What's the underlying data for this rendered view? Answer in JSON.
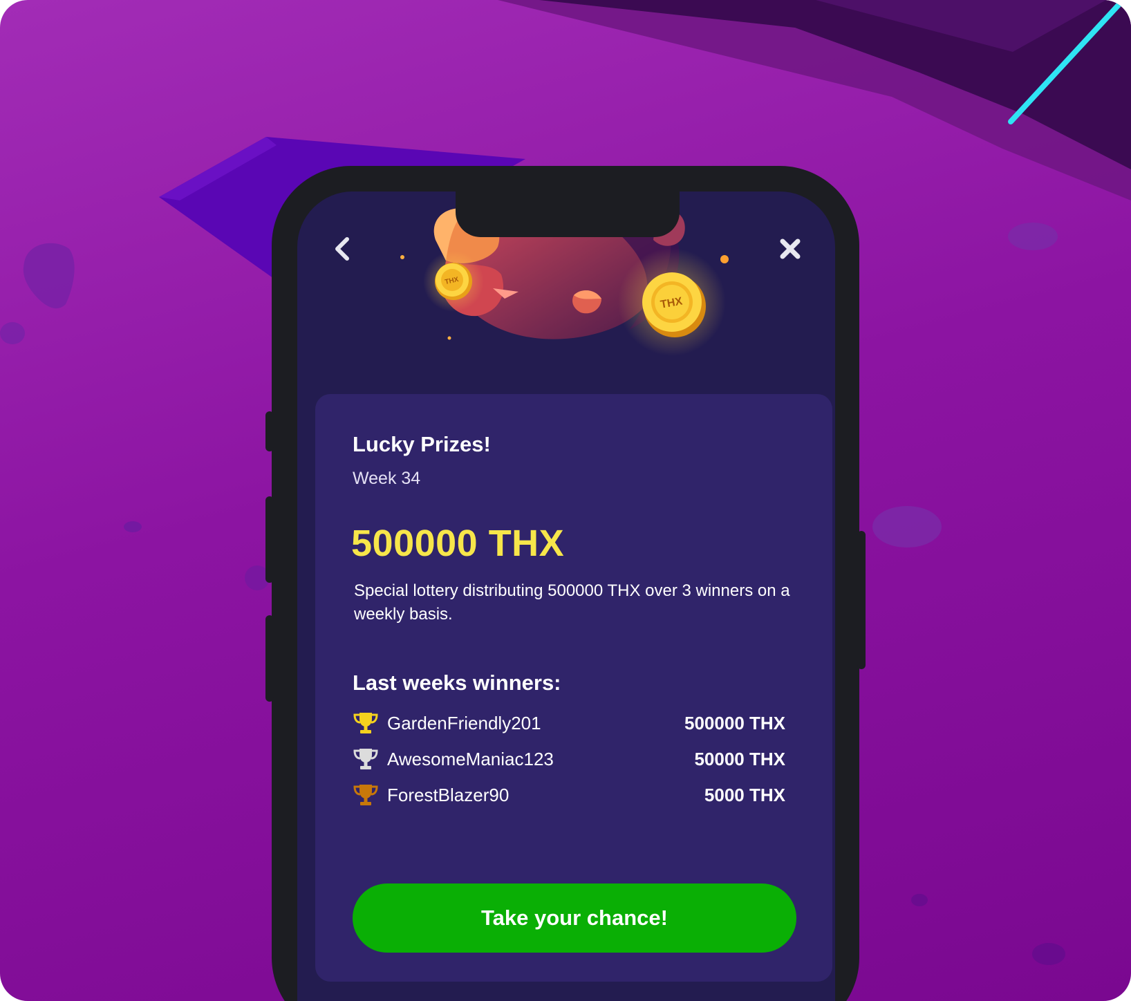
{
  "header": {
    "back_icon": "chevron-left-icon",
    "close_icon": "close-x-icon",
    "coin_label": "THX"
  },
  "card": {
    "title": "Lucky Prizes!",
    "subtitle": "Week 34",
    "prize_amount": "500000 THX",
    "description": "Special lottery distributing 500000 THX over 3 winners on a weekly basis.",
    "winners_title": "Last weeks winners:",
    "winners": [
      {
        "rank": "gold",
        "name": "GardenFriendly201",
        "amount": "500000 THX"
      },
      {
        "rank": "silver",
        "name": "AwesomeManiac123",
        "amount": "50000 THX"
      },
      {
        "rank": "bronze",
        "name": "ForestBlazer90",
        "amount": "5000 THX"
      }
    ],
    "cta_label": "Take your chance!"
  },
  "colors": {
    "background": "#9a22b0",
    "screen": "#231c50",
    "card": "#30246a",
    "accent_yellow": "#f7e64a",
    "cta_green": "#0aaf05",
    "trophy_gold": "#f5d21e",
    "trophy_silver": "#dcdcdc",
    "trophy_bronze": "#c8780a"
  }
}
